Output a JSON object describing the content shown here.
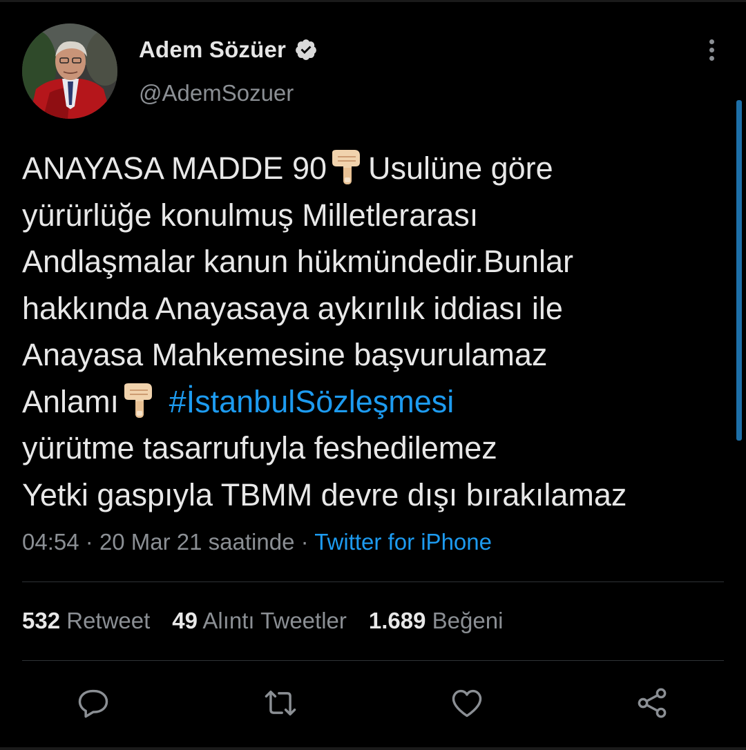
{
  "author": {
    "display_name": "Adem Sözüer",
    "handle": "@AdemSozuer",
    "verified": true
  },
  "tweet": {
    "lines": [
      [
        "ANAYASA MADDE 90",
        "Usulüne göre"
      ],
      "yürürlüğe konulmuş Milletlerarası",
      "Andlaşmalar kanun hükmündedir.Bunlar",
      "hakkında Anayasaya aykırılık iddiası ile",
      "Anayasa Mahkemesine başvurulamaz",
      [
        "Anlamı",
        "#İstanbulSözleşmesi"
      ],
      "yürütme tasarrufuyla feshedilemez",
      "Yetki gaspıyla TBMM devre dışı bırakılamaz"
    ],
    "emoji": "pointing-down-hand-icon"
  },
  "meta": {
    "time": "04:54",
    "separator": "·",
    "date": "20 Mar 21 saatinde",
    "source": "Twitter for iPhone"
  },
  "stats": {
    "retweets": {
      "count": "532",
      "label": "Retweet"
    },
    "quotes": {
      "count": "49",
      "label": "Alıntı Tweetler"
    },
    "likes": {
      "count": "1.689",
      "label": "Beğeni"
    }
  },
  "actions": [
    "reply-icon",
    "retweet-icon",
    "like-icon",
    "share-icon"
  ],
  "colors": {
    "background": "#000000",
    "text": "#e8e8e8",
    "secondary": "#8b8f94",
    "link": "#1d9bf0",
    "divider": "#2f3336"
  }
}
